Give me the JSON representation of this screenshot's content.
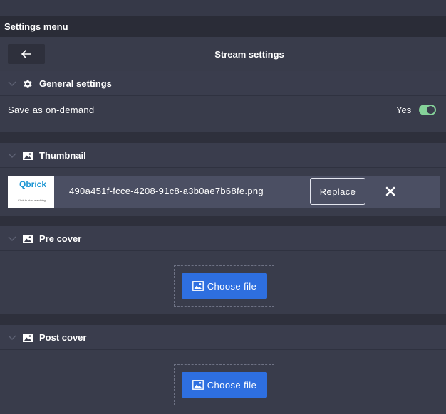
{
  "menu": {
    "title": "Settings menu"
  },
  "nav": {
    "back_icon": "arrow-left-icon",
    "title": "Stream settings"
  },
  "general": {
    "title": "General settings",
    "icon": "gear-icon",
    "on_demand_label": "Save as on-demand",
    "on_demand_value": "Yes",
    "on_demand_enabled": true,
    "toggle_color": "#86d39a"
  },
  "thumbnail": {
    "title": "Thumbnail",
    "icon": "image-icon",
    "logo_text": "Qbrick",
    "tagline": "Click to start watching",
    "file_name": "490a451f-fcce-4208-91c8-a3b0ae7b68fe.png",
    "replace_label": "Replace",
    "remove_icon": "close-icon"
  },
  "pre_cover": {
    "title": "Pre cover",
    "icon": "image-icon",
    "choose_label": "Choose file"
  },
  "post_cover": {
    "title": "Post cover",
    "icon": "image-icon",
    "choose_label": "Choose file"
  },
  "colors": {
    "background": "#393c4b",
    "header": "#2a2c37",
    "accent_button": "#2e6fe0",
    "file_row": "#4b4f63"
  }
}
